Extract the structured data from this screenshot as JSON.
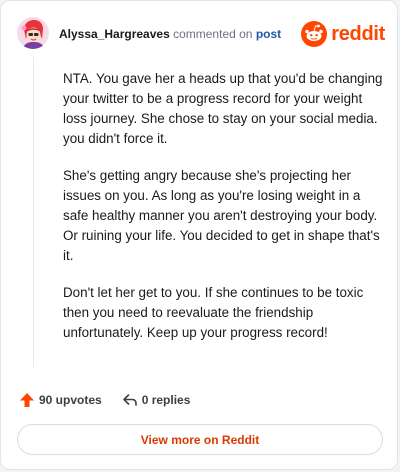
{
  "header": {
    "username": "Alyssa_Hargreaves",
    "commented_on": "commented on",
    "post_link": "post",
    "brand": "reddit"
  },
  "comment": {
    "paragraphs": [
      "NTA. You gave her a heads up that you'd be changing your twitter to be a progress record for your weight loss journey. She chose to stay on your social media. you didn't force it.",
      "She's getting angry because she's projecting her issues on you. As long as you're losing weight in a safe healthy manner you aren't destroying your body. Or ruining your life. You decided to get in shape that's it.",
      "Don't let her get to you. If she continues to be toxic then you need to reevaluate the friendship unfortunately. Keep up your progress record!"
    ]
  },
  "actions": {
    "upvotes": "90 upvotes",
    "replies": "0 replies"
  },
  "footer": {
    "view_more": "View more on Reddit"
  },
  "colors": {
    "brand": "#ff4500",
    "upvote": "#ff4500",
    "link": "#1d5aa8"
  },
  "icons": [
    "avatar",
    "reddit-logo-icon",
    "upvote-arrow-icon",
    "reply-icon"
  ]
}
